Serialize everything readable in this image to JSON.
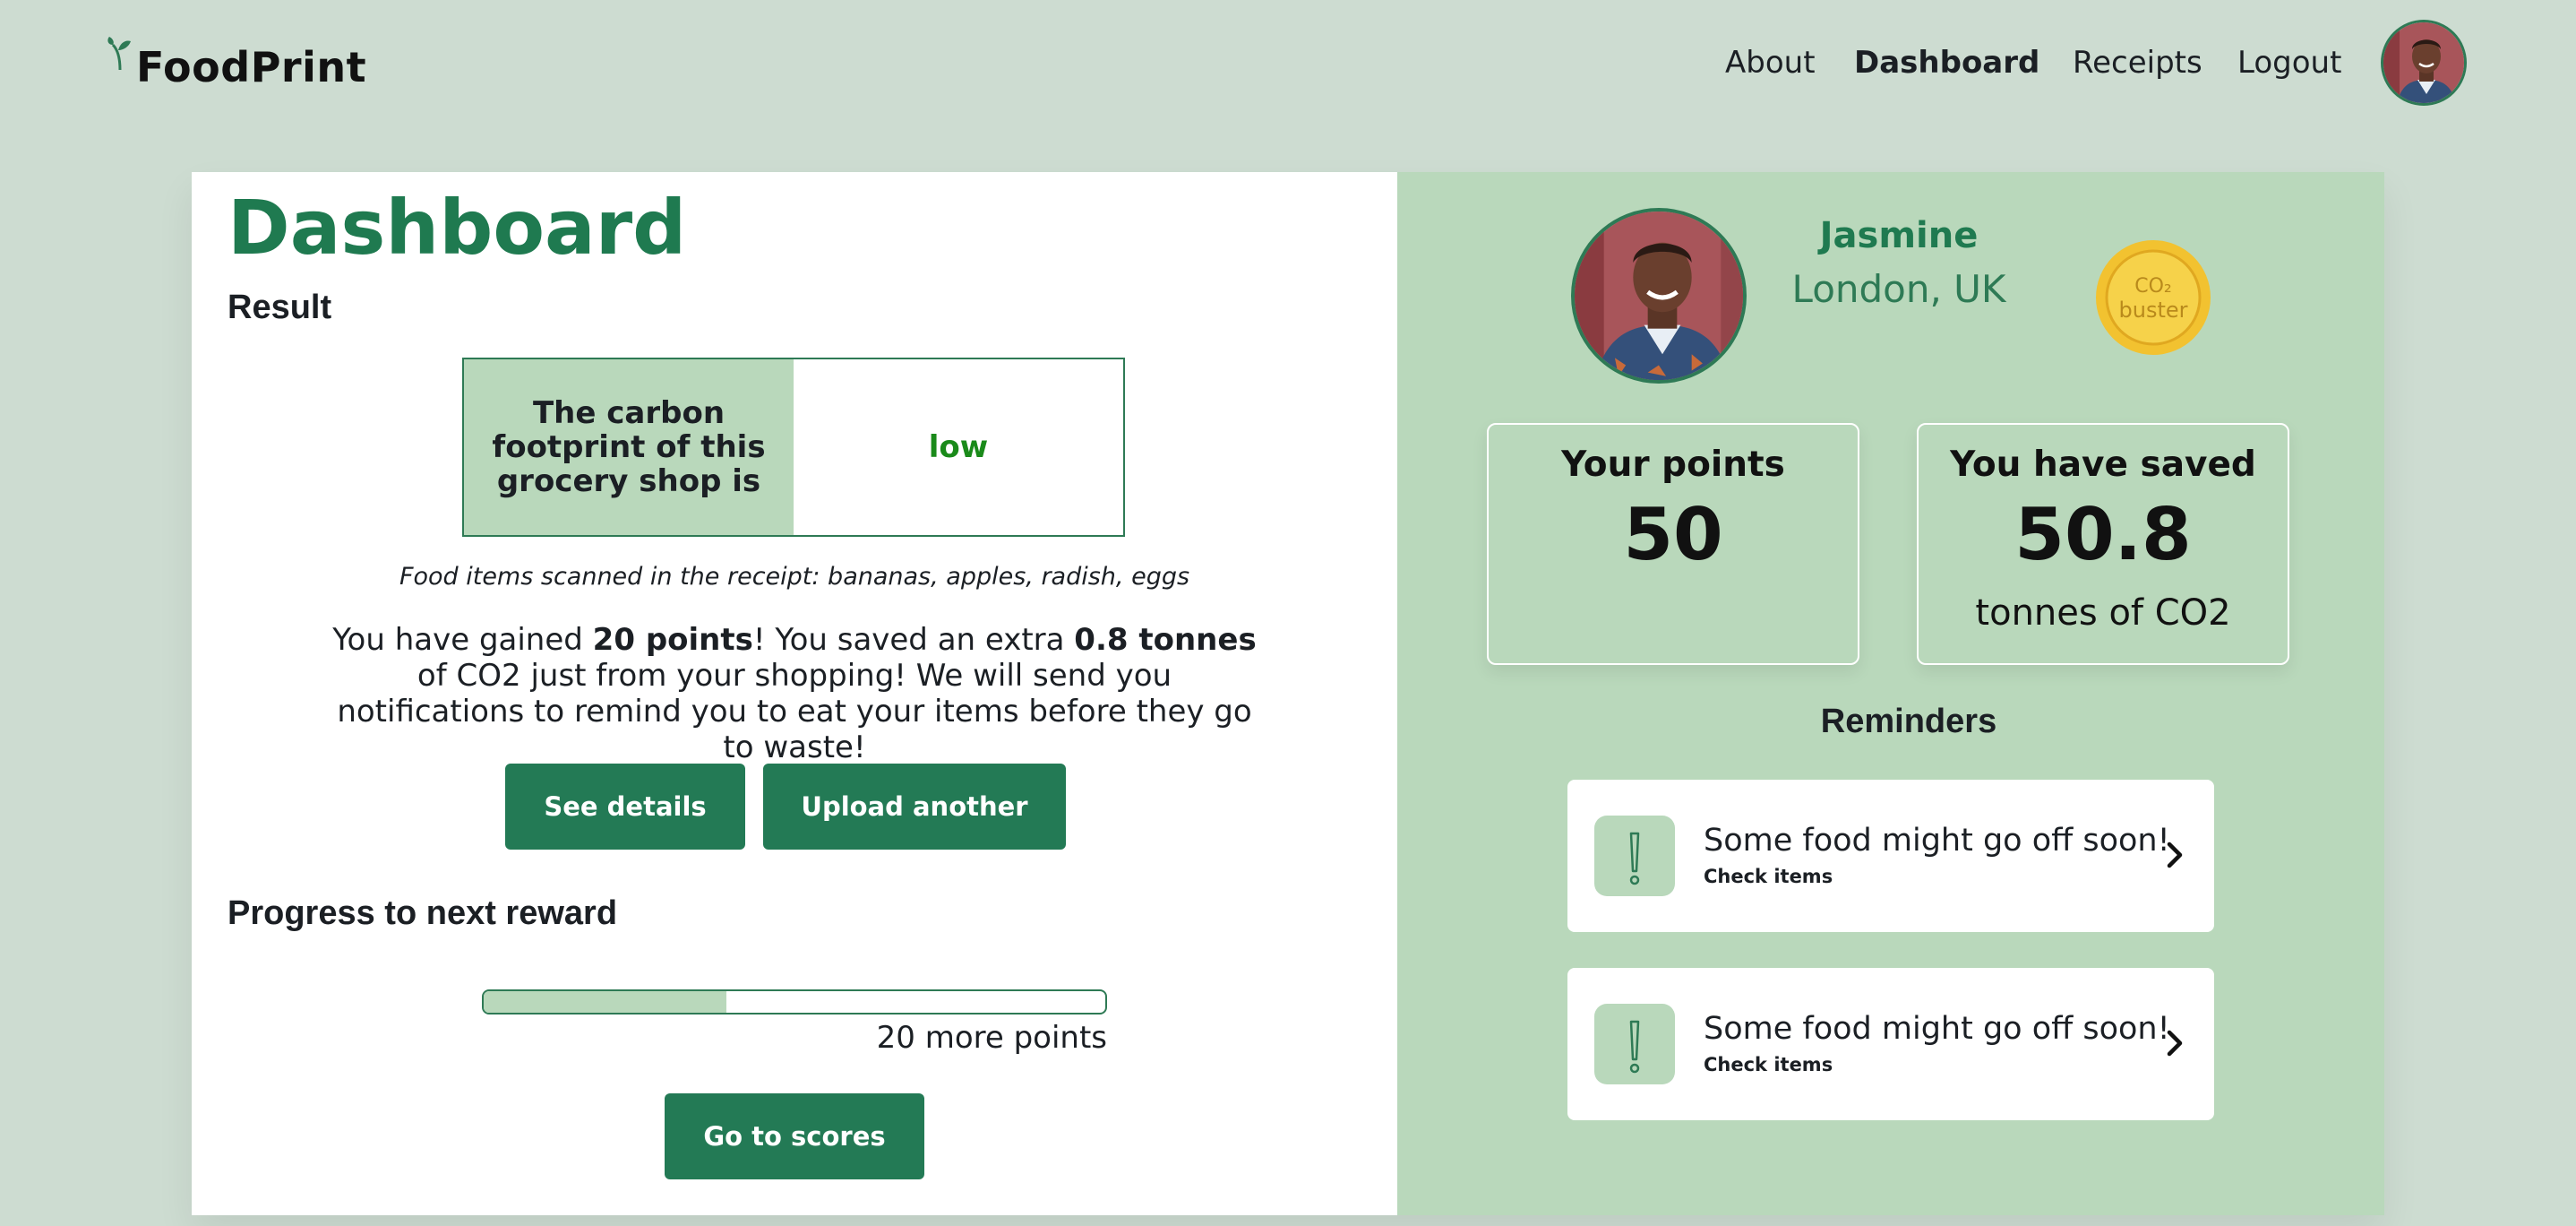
{
  "app": {
    "name": "FoodPrint",
    "accent_color": "#237a55",
    "background_color": "#cddcd1",
    "panel_color": "#b9d8bb"
  },
  "nav": {
    "items": [
      {
        "label": "About",
        "active": false
      },
      {
        "label": "Dashboard",
        "active": true
      },
      {
        "label": "Receipts",
        "active": false
      },
      {
        "label": "Logout",
        "active": false
      }
    ],
    "avatar_icon": "user-avatar"
  },
  "dashboard": {
    "title": "Dashboard",
    "result_heading": "Result",
    "result_question": "The carbon footprint of this grocery shop is",
    "result_value": "low",
    "result_value_color": "#1a8a1a",
    "scanned_text": "Food items scanned in the receipt: bananas, apples, radish, eggs",
    "gain": {
      "part1": "You have gained ",
      "points": "20 points",
      "part2": "! You saved an extra ",
      "tonnes": "0.8 tonnes",
      "part3": " of CO2 just from your shopping! We will send you notifications to remind you to eat your items before they go to waste!"
    },
    "see_details_label": "See details",
    "upload_another_label": "Upload another",
    "progress_heading": "Progress to next reward",
    "progress_fraction": 0.39,
    "progress_label": "20 more points",
    "go_to_scores_label": "Go to scores"
  },
  "profile": {
    "name": "Jasmine",
    "location": "London, UK",
    "badge_line1": "CO₂",
    "badge_line2": "buster"
  },
  "stats": {
    "points_label": "Your points",
    "points_value": "50",
    "saved_label": "You have saved",
    "saved_value": "50.8",
    "saved_unit": "tonnes of CO2"
  },
  "reminders": {
    "heading": "Reminders",
    "items": [
      {
        "text": "Some food might go off soon!",
        "action": "Check items",
        "icon": "exclamation-icon"
      },
      {
        "text": "Some food might go off soon!",
        "action": "Check items",
        "icon": "exclamation-icon"
      }
    ]
  }
}
